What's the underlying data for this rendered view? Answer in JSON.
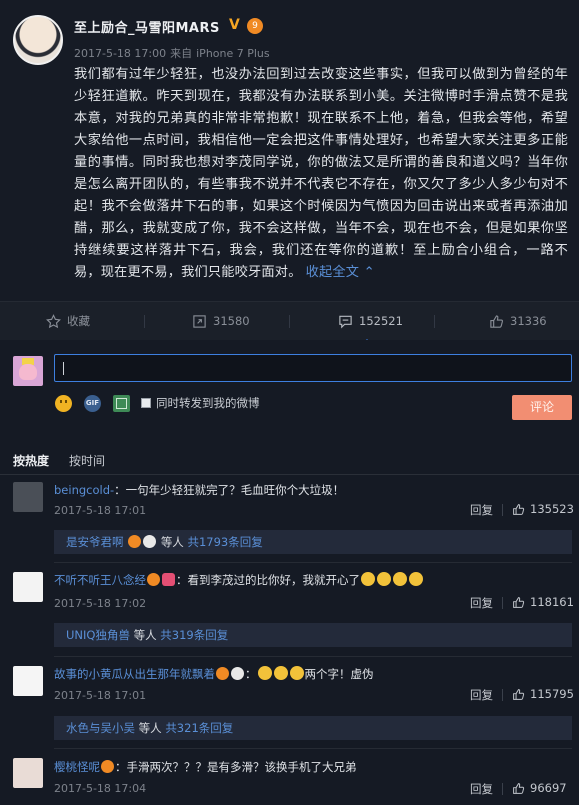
{
  "post": {
    "author": "至上励合_马雪阳MARS",
    "verified_mark": "V",
    "level_badge": "9",
    "time": "2017-5-18 17:00",
    "source_prefix": "来自",
    "source": "iPhone 7 Plus",
    "content": "我们都有过年少轻狂，也没办法回到过去改变这些事实，但我可以做到为曾经的年少轻狂道歉。昨天到现在，我都没有办法联系到小美。关注微博时手滑点赞不是我本意，对我的兄弟真的非常非常抱歉！现在联系不上他，着急，但我会等他，希望大家给他一点时间，我相信他一定会把这件事情处理好，也希望大家关注更多正能量的事情。同时我也想对李茂同学说，你的做法又是所谓的善良和道义吗？当年你是怎么离开团队的，有些事我不说并不代表它不存在，你又欠了多少人多少句对不起！我不会做落井下石的事，如果这个时候因为气愤因为回击说出来或者再添油加醋，那么，我就变成了你，我不会这样做，当年不会，现在也不会，但是如果你坚持继续要这样落井下石，我会，我们还在等你的道歉！至上励合小组合，一路不易，现在更不易，我们只能咬牙面对。",
    "collapse_label": "收起全文"
  },
  "actions": {
    "favorite_label": "收藏",
    "repost_count": "31580",
    "comment_count": "152521",
    "like_count": "31336"
  },
  "compose": {
    "placeholder": "",
    "repost_checkbox_label": "同时转发到我的微博",
    "submit_label": "评论"
  },
  "sort": {
    "by_hot": "按热度",
    "by_time": "按时间"
  },
  "comments": [
    {
      "user": "beingcold-",
      "text": "：一句年少轻狂就完了？毛血旺你个大垃圾！",
      "time": "2017-5-18 17:01",
      "reply_label": "回复",
      "likes": "135523",
      "reply_user": "是安爷君啊",
      "reply_suffix": "等人",
      "reply_count": "共1793条回复"
    },
    {
      "user": "不听不听王八念经",
      "text": "：看到李茂过的比你好，我就开心了",
      "time": "2017-5-18 17:02",
      "reply_label": "回复",
      "likes": "118161",
      "reply_user": "UNIQ独角兽",
      "reply_suffix": "等人",
      "reply_count": "共319条回复"
    },
    {
      "user": "故事的小黄瓜从出生那年就飘着",
      "text": "两个字！虚伪",
      "time": "2017-5-18 17:01",
      "reply_label": "回复",
      "likes": "115795",
      "reply_user": "水色与吴小吴",
      "reply_suffix": "等人",
      "reply_count": "共321条回复"
    },
    {
      "user": "樱桃怪呢",
      "text": "：手滑两次？？？是有多滑？该换手机了大兄弟",
      "time": "2017-5-18 17:04",
      "reply_label": "回复",
      "likes": "96697"
    }
  ],
  "colors": {
    "background": "#151a24",
    "link": "#5a8fd6",
    "accent": "#3d7fe0",
    "submit": "#f28e72"
  }
}
